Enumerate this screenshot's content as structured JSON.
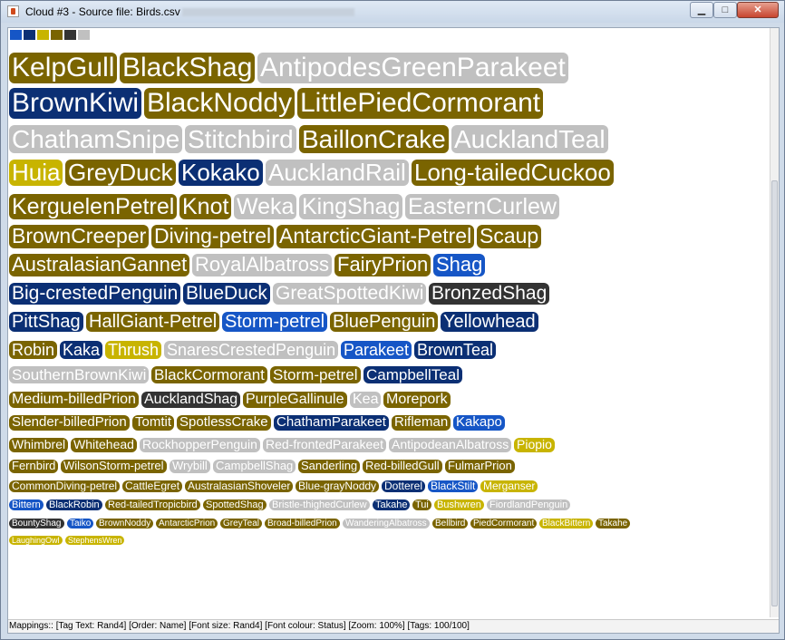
{
  "window": {
    "title": "Cloud #3 - Source file: Birds.csv",
    "minimize_glyph": "▁",
    "maximize_glyph": "□",
    "close_glyph": "✕"
  },
  "palette": [
    "#1656c6",
    "#0b2f74",
    "#c8b400",
    "#7a6400",
    "#333333",
    "#c0c0c0"
  ],
  "status_bar": "Mappings:: [Tag Text: Rand4]  [Order: Name]  [Font size: Rand4]  [Font colour: Status]  [Zoom: 100%]  [Tags: 100/100]",
  "tags": [
    {
      "text": "KelpGull",
      "c": "olive"
    },
    {
      "text": "BlackShag",
      "c": "olive"
    },
    {
      "text": "AntipodesGreenParakeet",
      "c": "grey"
    },
    {
      "text": "BrownKiwi",
      "c": "navy"
    },
    {
      "text": "BlackNoddy",
      "c": "olive"
    },
    {
      "text": "LittlePiedCormorant",
      "c": "olive"
    },
    {
      "text": "ChathamSnipe",
      "c": "grey"
    },
    {
      "text": "Stitchbird",
      "c": "grey"
    },
    {
      "text": "BaillonCrake",
      "c": "olive"
    },
    {
      "text": "AucklandTeal",
      "c": "grey"
    },
    {
      "text": "Huia",
      "c": "yellow"
    },
    {
      "text": "GreyDuck",
      "c": "olive"
    },
    {
      "text": "Kokako",
      "c": "navy"
    },
    {
      "text": "AucklandRail",
      "c": "grey"
    },
    {
      "text": "Long-tailedCuckoo",
      "c": "olive"
    },
    {
      "text": "KerguelenPetrel",
      "c": "olive"
    },
    {
      "text": "Knot",
      "c": "olive"
    },
    {
      "text": "Weka",
      "c": "grey"
    },
    {
      "text": "KingShag",
      "c": "grey"
    },
    {
      "text": "EasternCurlew",
      "c": "grey"
    },
    {
      "text": "BrownCreeper",
      "c": "olive"
    },
    {
      "text": "Diving-petrel",
      "c": "olive"
    },
    {
      "text": "AntarcticGiant-Petrel",
      "c": "olive"
    },
    {
      "text": "Scaup",
      "c": "olive"
    },
    {
      "text": "AustralasianGannet",
      "c": "olive"
    },
    {
      "text": "RoyalAlbatross",
      "c": "grey"
    },
    {
      "text": "FairyPrion",
      "c": "olive"
    },
    {
      "text": "Shag",
      "c": "blue"
    },
    {
      "text": "Big-crestedPenguin",
      "c": "navy"
    },
    {
      "text": "BlueDuck",
      "c": "navy"
    },
    {
      "text": "GreatSpottedKiwi",
      "c": "grey"
    },
    {
      "text": "BronzedShag",
      "c": "dark"
    },
    {
      "text": "PittShag",
      "c": "navy"
    },
    {
      "text": "HallGiant-Petrel",
      "c": "olive"
    },
    {
      "text": "Storm-petrel",
      "c": "blue"
    },
    {
      "text": "BluePenguin",
      "c": "olive"
    },
    {
      "text": "Yellowhead",
      "c": "navy"
    },
    {
      "text": "Robin",
      "c": "olive"
    },
    {
      "text": "Kaka",
      "c": "navy"
    },
    {
      "text": "Thrush",
      "c": "yellow"
    },
    {
      "text": "SnaresCrestedPenguin",
      "c": "grey"
    },
    {
      "text": "Parakeet",
      "c": "blue"
    },
    {
      "text": "BrownTeal",
      "c": "navy"
    },
    {
      "text": "SouthernBrownKiwi",
      "c": "grey"
    },
    {
      "text": "BlackCormorant",
      "c": "olive"
    },
    {
      "text": "Storm-petrel",
      "c": "olive"
    },
    {
      "text": "CampbellTeal",
      "c": "navy"
    },
    {
      "text": "Medium-billedPrion",
      "c": "olive"
    },
    {
      "text": "AucklandShag",
      "c": "dark"
    },
    {
      "text": "PurpleGallinule",
      "c": "olive"
    },
    {
      "text": "Kea",
      "c": "grey"
    },
    {
      "text": "Morepork",
      "c": "olive"
    },
    {
      "text": "Slender-billedPrion",
      "c": "olive"
    },
    {
      "text": "Tomtit",
      "c": "olive"
    },
    {
      "text": "SpotlessCrake",
      "c": "olive"
    },
    {
      "text": "ChathamParakeet",
      "c": "navy"
    },
    {
      "text": "Rifleman",
      "c": "olive"
    },
    {
      "text": "Kakapo",
      "c": "blue"
    },
    {
      "text": "Whimbrel",
      "c": "olive"
    },
    {
      "text": "Whitehead",
      "c": "olive"
    },
    {
      "text": "RockhopperPenguin",
      "c": "grey"
    },
    {
      "text": "Red-frontedParakeet",
      "c": "grey"
    },
    {
      "text": "AntipodeanAlbatross",
      "c": "grey"
    },
    {
      "text": "Piopio",
      "c": "yellow"
    },
    {
      "text": "Fernbird",
      "c": "olive"
    },
    {
      "text": "WilsonStorm-petrel",
      "c": "olive"
    },
    {
      "text": "Wrybill",
      "c": "grey"
    },
    {
      "text": "CampbellShag",
      "c": "grey"
    },
    {
      "text": "Sanderling",
      "c": "olive"
    },
    {
      "text": "Red-billedGull",
      "c": "olive"
    },
    {
      "text": "FulmarPrion",
      "c": "olive"
    },
    {
      "text": "CommonDiving-petrel",
      "c": "olive"
    },
    {
      "text": "CattleEgret",
      "c": "olive"
    },
    {
      "text": "AustralasianShoveler",
      "c": "olive"
    },
    {
      "text": "Blue-grayNoddy",
      "c": "olive"
    },
    {
      "text": "Dotterel",
      "c": "navy"
    },
    {
      "text": "BlackStilt",
      "c": "blue"
    },
    {
      "text": "Merganser",
      "c": "yellow"
    },
    {
      "text": "Bittern",
      "c": "blue"
    },
    {
      "text": "BlackRobin",
      "c": "navy"
    },
    {
      "text": "Red-tailedTropicbird",
      "c": "olive"
    },
    {
      "text": "SpottedShag",
      "c": "olive"
    },
    {
      "text": "Bristle-thighedCurlew",
      "c": "grey"
    },
    {
      "text": "Takahe",
      "c": "navy"
    },
    {
      "text": "Tui",
      "c": "olive"
    },
    {
      "text": "Bushwren",
      "c": "yellow"
    },
    {
      "text": "FiordlandPenguin",
      "c": "grey"
    },
    {
      "text": "BountyShag",
      "c": "dark"
    },
    {
      "text": "Taiko",
      "c": "blue"
    },
    {
      "text": "BrownNoddy",
      "c": "olive"
    },
    {
      "text": "AntarcticPrion",
      "c": "olive"
    },
    {
      "text": "GreyTeal",
      "c": "olive"
    },
    {
      "text": "Broad-billedPrion",
      "c": "olive"
    },
    {
      "text": "WanderingAlbatross",
      "c": "grey"
    },
    {
      "text": "Bellbird",
      "c": "olive"
    },
    {
      "text": "PiedCormorant",
      "c": "olive"
    },
    {
      "text": "BlackBittern",
      "c": "yellow"
    },
    {
      "text": "Takahe",
      "c": "olive"
    },
    {
      "text": "LaughingOwl",
      "c": "yellow"
    },
    {
      "text": "StephensWren",
      "c": "yellow"
    }
  ],
  "tag_colors": {
    "olive": {
      "bg": "#7a6400",
      "fg": "#ffffff"
    },
    "grey": {
      "bg": "#c0c0c0",
      "fg": "#ffffff"
    },
    "navy": {
      "bg": "#0b2f74",
      "fg": "#ffffff"
    },
    "blue": {
      "bg": "#1656c6",
      "fg": "#ffffff"
    },
    "yellow": {
      "bg": "#c8b400",
      "fg": "#ffffff"
    },
    "dark": {
      "bg": "#333333",
      "fg": "#ffffff"
    }
  }
}
